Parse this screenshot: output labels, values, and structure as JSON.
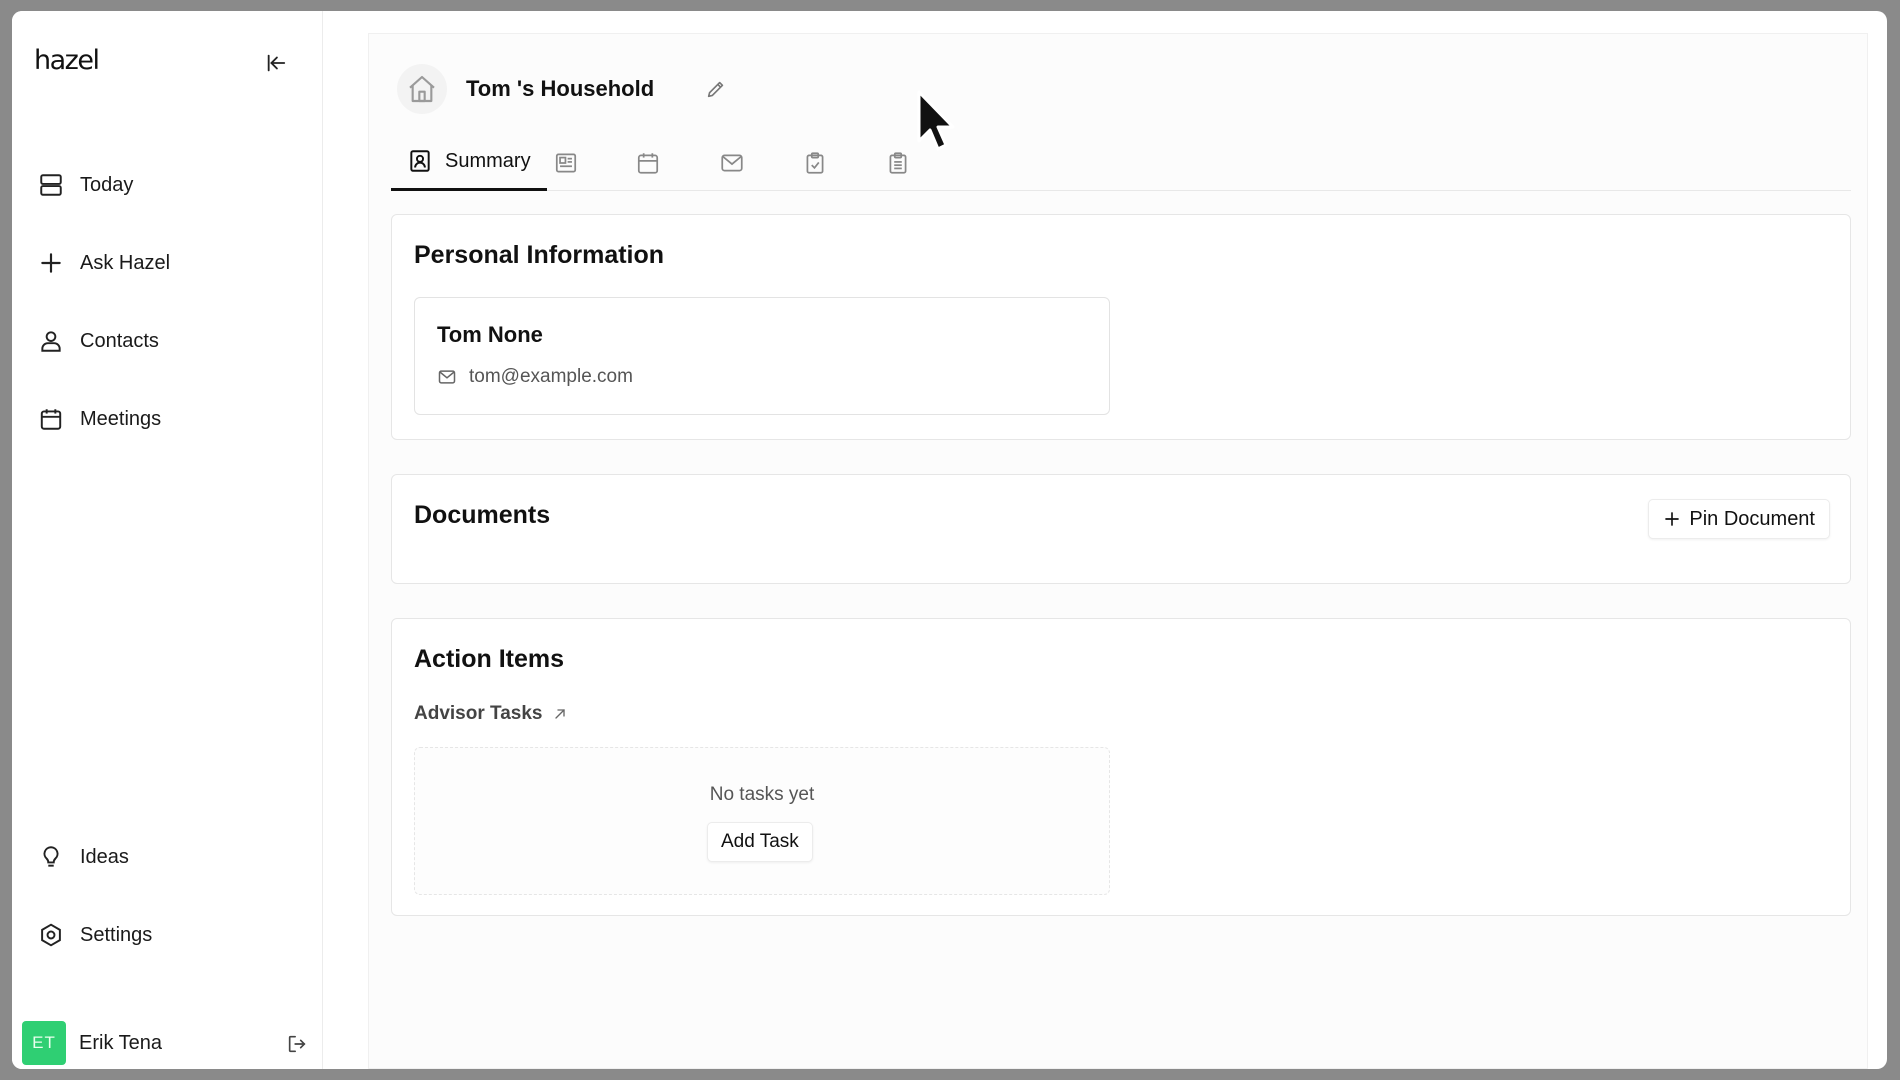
{
  "app": {
    "logo": "hazel"
  },
  "sidebar": {
    "items": [
      {
        "label": "Today",
        "icon": "today-icon"
      },
      {
        "label": "Ask Hazel",
        "icon": "plus-icon"
      },
      {
        "label": "Contacts",
        "icon": "person-icon"
      },
      {
        "label": "Meetings",
        "icon": "calendar-icon"
      }
    ],
    "bottom_items": [
      {
        "label": "Ideas",
        "icon": "lightbulb-icon"
      },
      {
        "label": "Settings",
        "icon": "gear-icon"
      }
    ],
    "user": {
      "initials": "ET",
      "name": "Erik Tena",
      "avatar_color": "#2fcf73"
    }
  },
  "household": {
    "title": "Tom 's Household"
  },
  "tabs": [
    {
      "label": "Summary",
      "icon": "contact-card-icon",
      "active": true
    },
    {
      "label": "",
      "icon": "document-icon"
    },
    {
      "label": "",
      "icon": "calendar-icon"
    },
    {
      "label": "",
      "icon": "mail-icon"
    },
    {
      "label": "",
      "icon": "clipboard-check-icon"
    },
    {
      "label": "",
      "icon": "clipboard-list-icon"
    }
  ],
  "personal_info": {
    "title": "Personal Information",
    "name": "Tom None",
    "email": "tom@example.com"
  },
  "documents": {
    "title": "Documents",
    "pin_button": "Pin Document"
  },
  "action_items": {
    "title": "Action Items",
    "subheading": "Advisor Tasks",
    "empty_text": "No tasks yet",
    "add_button": "Add Task"
  }
}
